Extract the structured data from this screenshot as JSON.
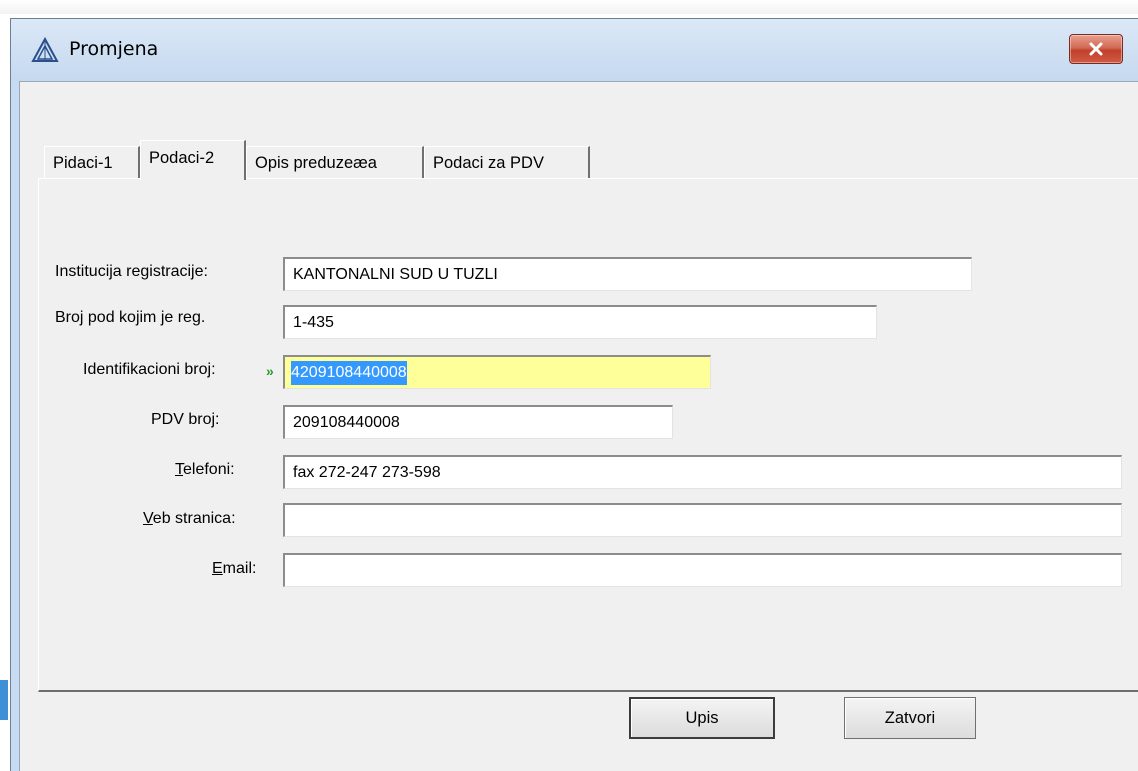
{
  "window": {
    "title": "Promjena",
    "icon": "triangle-logo-icon",
    "close_icon": "close-x-icon"
  },
  "tabs": [
    {
      "label": "Pidaci-1",
      "active": false
    },
    {
      "label": "Podaci-2",
      "active": true
    },
    {
      "label": "Opis preduzeæa",
      "active": false
    },
    {
      "label": "Podaci za PDV",
      "active": false
    }
  ],
  "form": {
    "institucija": {
      "label": "Institucija registracije:",
      "value": "KANTONALNI SUD U TUZLI"
    },
    "broj_reg": {
      "label": "Broj pod kojim je reg.",
      "value": "1-435"
    },
    "id_broj": {
      "label": "Identifikacioni broj:",
      "marker": "»",
      "value": "4209108440008"
    },
    "pdv_broj": {
      "label": "PDV broj:",
      "value": "209108440008"
    },
    "telefoni": {
      "accel": "T",
      "label_rest": "elefoni:",
      "value": "fax 272-247 273-598"
    },
    "veb": {
      "accel": "V",
      "label_rest": "eb stranica:",
      "value": ""
    },
    "email": {
      "accel": "E",
      "label_rest": "mail:",
      "value": ""
    }
  },
  "buttons": {
    "upis": "Upis",
    "zatvori": "Zatvori"
  },
  "colors": {
    "focus_field": "#ffff99",
    "selection": "#3399ff",
    "close_button": "#c1412b"
  }
}
